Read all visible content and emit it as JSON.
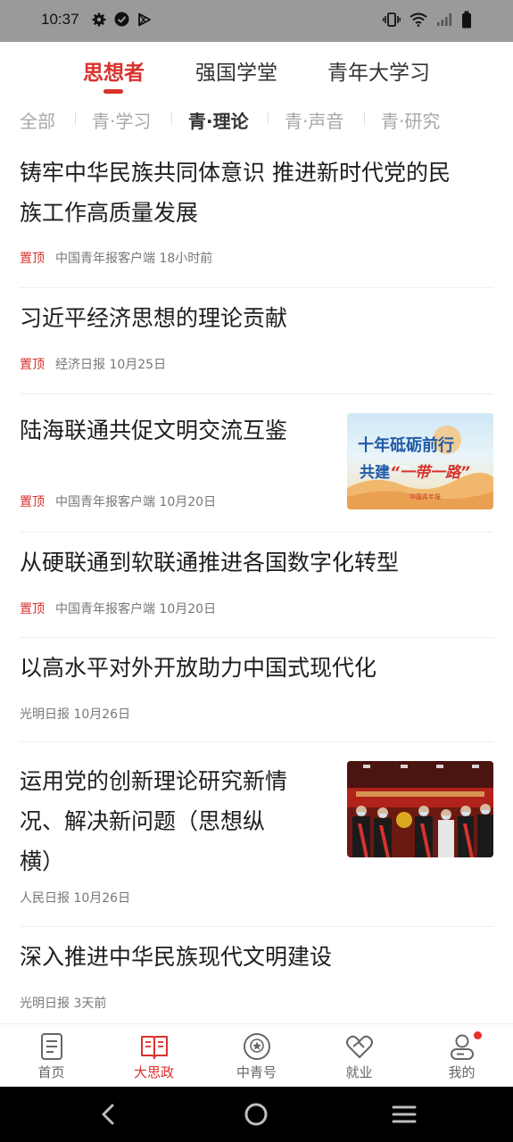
{
  "status_bar": {
    "time": "10:37",
    "left_icons": [
      "gear-icon",
      "check-circle-icon",
      "play-store-icon"
    ],
    "right_icons": [
      "vibrate-icon",
      "wifi-icon",
      "signal-icon",
      "battery-icon"
    ]
  },
  "top_tabs": [
    {
      "label": "思想者",
      "active": true
    },
    {
      "label": "强国学堂",
      "active": false
    },
    {
      "label": "青年大学习",
      "active": false
    }
  ],
  "sub_tabs": [
    {
      "label": "全部",
      "active": false
    },
    {
      "label": "青·学习",
      "active": false
    },
    {
      "label": "青·理论",
      "active": true
    },
    {
      "label": "青·声音",
      "active": false
    },
    {
      "label": "青·研究",
      "active": false
    }
  ],
  "articles": [
    {
      "title_lines": [
        "铸牢中华民族共同体意识 推进新时代党的民",
        "族工作高质量发展"
      ],
      "pinned": "置顶",
      "source": "中国青年报客户端",
      "time": "18小时前"
    },
    {
      "title_lines": [
        "习近平经济思想的理论贡献"
      ],
      "pinned": "置顶",
      "source": "经济日报",
      "time": "10月25日"
    },
    {
      "title_lines": [
        "陆海联通共促文明交流互鉴"
      ],
      "pinned": "置顶",
      "source": "中国青年报客户端",
      "time": "10月20日",
      "thumb": {
        "line1": "十年砥砺前行",
        "line2_prefix": "共建",
        "line2_accent": "“一带一路”",
        "logo": "中国青年报"
      }
    },
    {
      "title_lines": [
        "从硬联通到软联通推进各国数字化转型"
      ],
      "pinned": "置顶",
      "source": "中国青年报客户端",
      "time": "10月20日"
    },
    {
      "title_lines": [
        "以高水平对外开放助力中国式现代化"
      ],
      "pinned": "",
      "source": "光明日报",
      "time": "10月26日"
    },
    {
      "title_lines": [
        "运用党的创新理论研究新情",
        "况、解决新问题（思想纵",
        "横）"
      ],
      "pinned": "",
      "source": "人民日报",
      "time": "10月26日",
      "thumb": {
        "kind": "photo"
      }
    },
    {
      "title_lines": [
        "深入推进中华民族现代文明建设"
      ],
      "pinned": "",
      "source": "光明日报",
      "time": "3天前"
    }
  ],
  "bottom_nav": [
    {
      "label": "首页",
      "icon": "document-icon",
      "active": false
    },
    {
      "label": "大思政",
      "icon": "open-book-icon",
      "active": true
    },
    {
      "label": "中青号",
      "icon": "star-badge-icon",
      "active": false
    },
    {
      "label": "就业",
      "icon": "heart-handshake-icon",
      "active": false
    },
    {
      "label": "我的",
      "icon": "user-icon",
      "active": false,
      "badge": true
    }
  ],
  "system_nav": [
    "back-icon",
    "home-icon",
    "menu-icon"
  ],
  "colors": {
    "accent": "#d9322d",
    "text": "#1e1e1e",
    "meta": "#777777",
    "status_bar": "#9a9a9a"
  }
}
